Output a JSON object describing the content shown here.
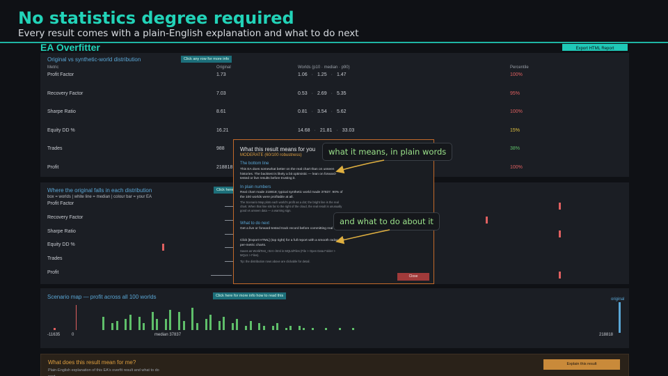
{
  "banner": {
    "title": "No statistics degree required",
    "subtitle": "Every result comes with a plain-English explanation and what to do next"
  },
  "app": {
    "title": "EA Overfitter",
    "export_label": "Export HTML Report"
  },
  "distribution": {
    "title": "Original vs synthetic-world distribution",
    "button": "Click any row for more info",
    "headers": {
      "metric": "Metric",
      "original": "Original",
      "worlds": "Worlds  (p10 · median · p90)",
      "percentile": "Percentile"
    },
    "rows": [
      {
        "metric": "Profit Factor",
        "original": "1.73",
        "p10": "1.06",
        "median": "1.25",
        "p90": "1.47",
        "percentile": "100%",
        "color": "#e06060"
      },
      {
        "metric": "Recovery Factor",
        "original": "7.03",
        "p10": "0.53",
        "median": "2.69",
        "p90": "5.35",
        "percentile": "95%",
        "color": "#e06060"
      },
      {
        "metric": "Sharpe Ratio",
        "original": "8.61",
        "p10": "0.81",
        "median": "3.54",
        "p90": "5.62",
        "percentile": "100%",
        "color": "#e06060"
      },
      {
        "metric": "Equity DD %",
        "original": "16.21",
        "p10": "14.68",
        "median": "21.81",
        "p90": "33.03",
        "percentile": "15%",
        "color": "#e0c040"
      },
      {
        "metric": "Trades",
        "original": "988",
        "p10": "",
        "median": "",
        "p90": "",
        "percentile": "38%",
        "color": "#5fbf6a"
      },
      {
        "metric": "Profit",
        "original": "218818.",
        "p10": "",
        "median": "",
        "p90": "",
        "percentile": "100%",
        "color": "#e06060"
      }
    ],
    "separator": "·"
  },
  "where": {
    "title": "Where the original falls in each distribution",
    "button": "Click here",
    "legend": "box = worlds  |  white line = median  |  colour bar = your EA",
    "rows": [
      {
        "label": "Profit Factor",
        "tick": 0.86
      },
      {
        "label": "Recovery Factor",
        "tick": 0.72
      },
      {
        "label": "Sharpe Ratio",
        "tick": 0.86
      },
      {
        "label": "Equity DD %",
        "tick": 0.1
      },
      {
        "label": "Trades",
        "tick": 0.35
      },
      {
        "label": "Profit",
        "tick": 0.86
      }
    ]
  },
  "scenario": {
    "title": "Scenario map — profit across all 100 worlds",
    "button": "Click here for more info how to read this",
    "labels": {
      "min": "-11635",
      "zero": "0",
      "median": "median 37837",
      "max": "218818",
      "original": "original"
    },
    "bars": [
      1,
      0,
      0,
      0,
      0,
      0,
      0,
      0,
      0,
      0,
      0,
      6,
      0,
      3,
      4,
      0,
      5,
      7,
      0,
      6,
      3,
      0,
      8,
      5,
      0,
      5,
      9,
      0,
      8,
      4,
      0,
      10,
      3,
      0,
      5,
      7,
      0,
      4,
      6,
      0,
      3,
      5,
      0,
      2,
      4,
      0,
      3,
      2,
      0,
      2,
      3,
      0,
      1,
      2,
      0,
      2,
      1,
      0,
      1,
      0,
      0,
      1,
      0,
      0,
      1,
      0,
      0,
      1
    ]
  },
  "meaning": {
    "title": "What does this result mean for me?",
    "subtitle": "Plain-English explanation of this EA's overfit result and what to do next.",
    "button": "Explain this result"
  },
  "modal": {
    "title": "What this result means for you",
    "verdict": "MODERATE   (60/100 robustness)",
    "bottom_line_h": "The bottom line",
    "bottom_line": "This EA does somewhat better on the real chart than on unseen histories. The backtest is likely a bit optimistic — lean on forward-tested or live results before trusting it.",
    "numbers_h": "In plain numbers",
    "numbers": "Real chart made 218818;  typical synthetic world made 37837. 90% of the 100 worlds were profitable at all.",
    "numbers_note": "The Scenario Map plots each world's profit as a dot; the bright line is the real chart. When that line sits far to the right of the cloud, the real result is unusually good vs unseen data — a warning sign.",
    "next_h": "What to do next",
    "next1": "Get a live or forward-tested track record before committing real money.",
    "next2": "Click [Export HTML] (top right) for a full report with a smooth radar and per-metric charts.",
    "next_note": "Saves as WorldTest_<EA>.html in MQL5/Files (File > Open Data Folder > MQL5 > Files).",
    "tip": "Tip: the distribution rows above are clickable for detail.",
    "close": "Close"
  },
  "callouts": {
    "top": "what it means, in plain words",
    "bottom": "and what to do about it"
  }
}
